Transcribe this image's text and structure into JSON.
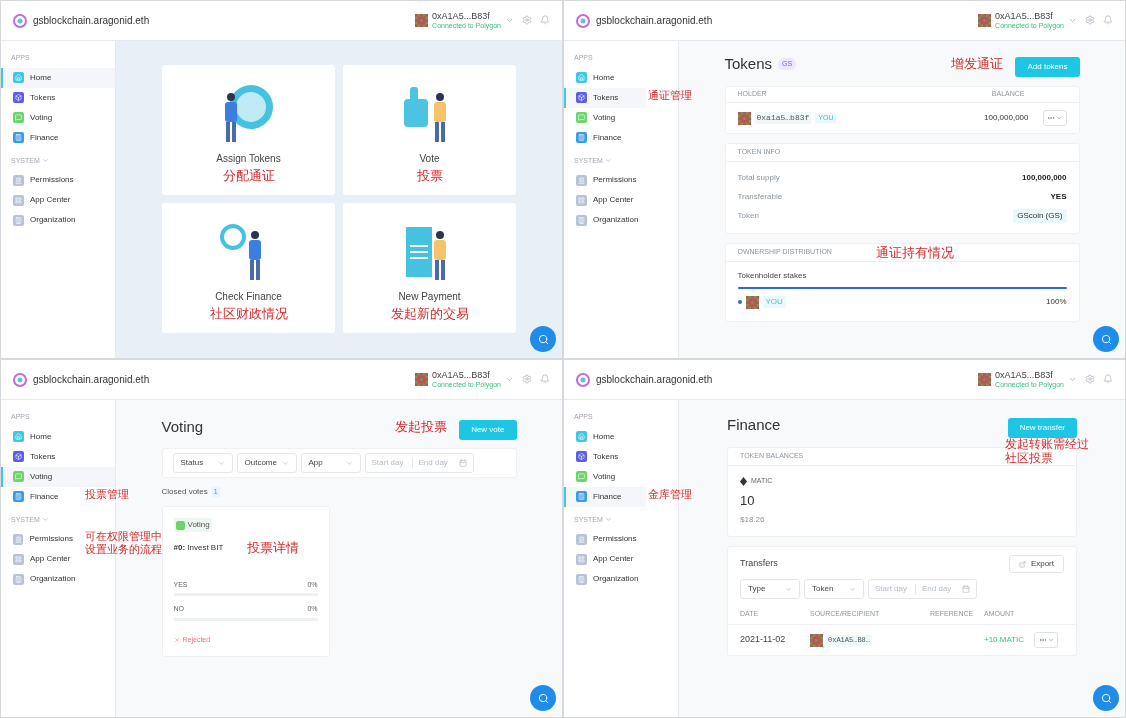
{
  "panels": [
    {
      "kind": "home",
      "header": {
        "org": "gsblockchain.aragonid.eth",
        "account": "0xA1A5...B83f",
        "network": "Connected to Polygon"
      },
      "sidebar": {
        "apps_label": "APPS",
        "apps": [
          {
            "label": "Home",
            "color": "#3fc8e4",
            "selected": true
          },
          {
            "label": "Tokens",
            "color": "#5b5ee8",
            "selected": false
          },
          {
            "label": "Voting",
            "color": "#6bd56a",
            "selected": false
          },
          {
            "label": "Finance",
            "color": "#3a9be8",
            "selected": false
          }
        ],
        "system_label": "SYSTEM",
        "system": [
          {
            "label": "Permissions"
          },
          {
            "label": "App Center"
          },
          {
            "label": "Organization"
          }
        ]
      },
      "cards": [
        {
          "title": "Assign Tokens",
          "note": "分配通证"
        },
        {
          "title": "Vote",
          "note": "投票"
        },
        {
          "title": "Check Finance",
          "note": "社区财政情况"
        },
        {
          "title": "New Payment",
          "note": "发起新的交易"
        }
      ]
    },
    {
      "kind": "tokens",
      "header": {
        "org": "gsblockchain.aragonid.eth",
        "account": "0xA1A5...B83f",
        "network": "Connected to Polygon"
      },
      "sidebar": {
        "apps_label": "APPS",
        "apps": [
          {
            "label": "Home",
            "color": "#3fc8e4",
            "selected": false
          },
          {
            "label": "Tokens",
            "color": "#5b5ee8",
            "selected": true,
            "note": "通证管理"
          },
          {
            "label": "Voting",
            "color": "#6bd56a",
            "selected": false
          },
          {
            "label": "Finance",
            "color": "#3a9be8",
            "selected": false
          }
        ],
        "system_label": "SYSTEM",
        "system": [
          {
            "label": "Permissions"
          },
          {
            "label": "App Center"
          },
          {
            "label": "Organization"
          }
        ]
      },
      "title": "Tokens",
      "symbol": "GS",
      "action_note": "增发通证",
      "action": "Add tokens",
      "holders": {
        "columns": [
          "HOLDER",
          "BALANCE"
        ],
        "rows": [
          {
            "address": "0xa1a5…b83f",
            "tag": "YOU",
            "balance": "100,000,000"
          }
        ]
      },
      "token_info": {
        "heading": "TOKEN INFO",
        "rows": [
          {
            "label": "Total supply",
            "value": "100,000,000",
            "kind": "text"
          },
          {
            "label": "Transferable",
            "value": "YES",
            "kind": "text"
          },
          {
            "label": "Token",
            "value": "GScoin (GS)",
            "kind": "tag"
          }
        ]
      },
      "distribution": {
        "heading": "OWNERSHIP DISTRIBUTION",
        "note": "通证持有情况",
        "subtitle": "Tokenholder stakes",
        "level": 1,
        "stakes": [
          {
            "tag": "YOU",
            "share": "100%",
            "color": "#2d6ae0"
          }
        ]
      }
    },
    {
      "kind": "voting",
      "header": {
        "org": "gsblockchain.aragonid.eth",
        "account": "0xA1A5...B83f",
        "network": "Connected to Polygon"
      },
      "sidebar": {
        "apps_label": "APPS",
        "apps": [
          {
            "label": "Home",
            "color": "#3fc8e4",
            "selected": false
          },
          {
            "label": "Tokens",
            "color": "#5b5ee8",
            "selected": false
          },
          {
            "label": "Voting",
            "color": "#6bd56a",
            "selected": true
          },
          {
            "label": "Finance",
            "color": "#3a9be8",
            "selected": false,
            "note": "投票管理"
          }
        ],
        "system_label": "SYSTEM",
        "system": [
          {
            "label": "Permissions",
            "note": "可在权限管理中设置业务的流程"
          },
          {
            "label": "App Center"
          },
          {
            "label": "Organization"
          }
        ]
      },
      "title": "Voting",
      "action_note": "发起投票",
      "action": "New vote",
      "filters": [
        {
          "kind": "select",
          "label": "Status"
        },
        {
          "kind": "select",
          "label": "Outcome"
        },
        {
          "kind": "select",
          "label": "App"
        },
        {
          "kind": "date_range",
          "start_placeholder": "Start day",
          "end_placeholder": "End day"
        }
      ],
      "section": "Closed votes",
      "count": "1",
      "vote": {
        "app": "Voting",
        "title": "**#0:** Invest BIT",
        "note": "投票详情",
        "options": [
          {
            "label": "YES",
            "percent": "0%"
          },
          {
            "label": "NO",
            "percent": "0%"
          }
        ],
        "status": "Rejected"
      }
    },
    {
      "kind": "finance",
      "header": {
        "org": "gsblockchain.aragonid.eth",
        "account": "0xA1A5...B83f",
        "network": "Connected to Polygon"
      },
      "sidebar": {
        "apps_label": "APPS",
        "apps": [
          {
            "label": "Home",
            "color": "#3fc8e4",
            "selected": false
          },
          {
            "label": "Tokens",
            "color": "#5b5ee8",
            "selected": false
          },
          {
            "label": "Voting",
            "color": "#6bd56a",
            "selected": false
          },
          {
            "label": "Finance",
            "color": "#3a9be8",
            "selected": true,
            "note": "金库管理"
          }
        ],
        "system_label": "SYSTEM",
        "system": [
          {
            "label": "Permissions"
          },
          {
            "label": "App Center"
          },
          {
            "label": "Organization"
          }
        ]
      },
      "title": "Finance",
      "action": "New transfer",
      "action_note": "发起转账需经过社区投票",
      "balances": {
        "heading": "TOKEN BALANCES",
        "token": "MATIC",
        "amount": "10",
        "fiat": "$18.26"
      },
      "transfers": {
        "title": "Transfers",
        "export": "Export",
        "filters": [
          {
            "kind": "select",
            "label": "Type"
          },
          {
            "kind": "select",
            "label": "Token"
          },
          {
            "kind": "date_range",
            "start_placeholder": "Start day",
            "end_placeholder": "End day"
          }
        ],
        "columns": [
          "DATE",
          "SOURCE/RECIPIENT",
          "REFERENCE",
          "AMOUNT"
        ],
        "rows": [
          {
            "date": "2021-11-02",
            "address": "0xA1A5…B8…",
            "amount": "+10 MATIC"
          }
        ]
      }
    }
  ]
}
